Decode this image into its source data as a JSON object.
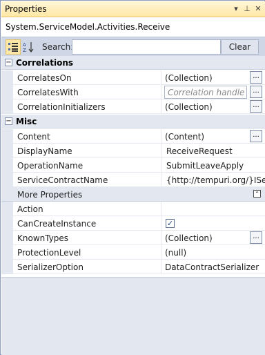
{
  "window": {
    "title": "Properties",
    "buttons": [
      "dropdown-icon",
      "pin-icon",
      "close-icon"
    ]
  },
  "object": {
    "name": "System.ServiceModel.Activities.Receive"
  },
  "toolbar": {
    "search_label": "Search:",
    "search_value": "",
    "clear_label": "Clear"
  },
  "categories": {
    "correlations": {
      "label": "Correlations",
      "toggle": "−",
      "props": [
        {
          "name": "CorrelatesOn",
          "value": "(Collection)"
        },
        {
          "name": "CorrelatesWith",
          "value": "Correlation handle"
        },
        {
          "name": "CorrelationInitializers",
          "value": "(Collection)"
        }
      ]
    },
    "misc": {
      "label": "Misc",
      "toggle": "−",
      "props": [
        {
          "name": "Content",
          "value": "(Content)"
        },
        {
          "name": "DisplayName",
          "value": "ReceiveRequest"
        },
        {
          "name": "OperationName",
          "value": "SubmitLeaveApply"
        },
        {
          "name": "ServiceContractName",
          "value": "{http://tempuri.org/}IServi"
        }
      ]
    },
    "more": {
      "label": "More Properties",
      "props": [
        {
          "name": "Action",
          "value": ""
        },
        {
          "name": "CanCreateInstance",
          "value": "✓"
        },
        {
          "name": "KnownTypes",
          "value": "(Collection)"
        },
        {
          "name": "ProtectionLevel",
          "value": "(null)"
        },
        {
          "name": "SerializerOption",
          "value": "DataContractSerializer"
        }
      ]
    }
  },
  "ellipsis": "..."
}
